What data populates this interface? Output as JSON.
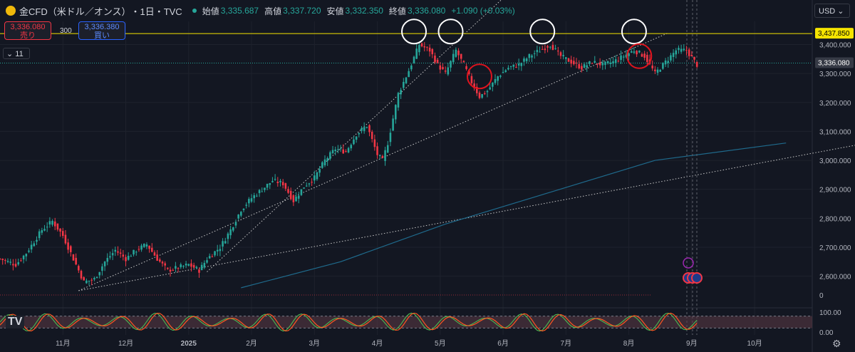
{
  "header": {
    "symbol": "金CFD（米ドル／オンス）",
    "interval": "・1日・TVC",
    "open_label": "始値",
    "open": "3,335.687",
    "high_label": "高値",
    "high": "3,337.720",
    "low_label": "安値",
    "low": "3,332.350",
    "close_label": "終値",
    "close": "3,336.080",
    "change": "+1.090 (+0.03%)"
  },
  "trade": {
    "sell_price": "3,336.080",
    "sell_label": "売り",
    "quantity": "300",
    "buy_price": "3,336.380",
    "buy_label": "買い"
  },
  "indicator_toggle": "11",
  "currency": "USD",
  "colors": {
    "up": "#26a69a",
    "down": "#f23645",
    "background": "#131722",
    "level_line": "#f5e400",
    "ma": "#1f6a8c",
    "stoch_k": "#4caf50",
    "stoch_d": "#ff5722"
  },
  "chart_data": {
    "type": "candlestick",
    "x_tick_labels": [
      "11月",
      "12月",
      "2025",
      "2月",
      "3月",
      "4月",
      "5月",
      "6月",
      "7月",
      "8月",
      "9月",
      "10月"
    ],
    "y_tick_labels": [
      "3,400.000",
      "3,300.000",
      "3,200.000",
      "3,100.000",
      "3,000.000",
      "2,900.000",
      "2,800.000",
      "2,700.000",
      "2,600.000"
    ],
    "ylim": [
      2540,
      3480
    ],
    "current_price": "3,336.080",
    "resistance_level": "3,437.850",
    "volume_axis_label": "0",
    "oscillator": {
      "tick_labels": [
        "100.00",
        "0.00"
      ],
      "ylim": [
        0,
        100
      ],
      "band": [
        20,
        80
      ]
    },
    "price_path": [
      [
        0,
        2660
      ],
      [
        6,
        2640
      ],
      [
        10,
        2680
      ],
      [
        16,
        2760
      ],
      [
        20,
        2790
      ],
      [
        24,
        2740
      ],
      [
        28,
        2660
      ],
      [
        32,
        2580
      ],
      [
        36,
        2590
      ],
      [
        40,
        2650
      ],
      [
        44,
        2690
      ],
      [
        48,
        2660
      ],
      [
        52,
        2690
      ],
      [
        56,
        2710
      ],
      [
        60,
        2660
      ],
      [
        64,
        2620
      ],
      [
        68,
        2630
      ],
      [
        72,
        2640
      ],
      [
        76,
        2620
      ],
      [
        79,
        2660
      ],
      [
        84,
        2700
      ],
      [
        88,
        2760
      ],
      [
        92,
        2830
      ],
      [
        96,
        2870
      ],
      [
        100,
        2900
      ],
      [
        104,
        2930
      ],
      [
        108,
        2920
      ],
      [
        112,
        2860
      ],
      [
        116,
        2910
      ],
      [
        120,
        2940
      ],
      [
        124,
        3000
      ],
      [
        128,
        3040
      ],
      [
        132,
        3030
      ],
      [
        136,
        3090
      ],
      [
        140,
        3120
      ],
      [
        144,
        3020
      ],
      [
        146,
        3000
      ],
      [
        148,
        3060
      ],
      [
        152,
        3230
      ],
      [
        156,
        3310
      ],
      [
        160,
        3400
      ],
      [
        164,
        3380
      ],
      [
        167,
        3330
      ],
      [
        170,
        3300
      ],
      [
        174,
        3380
      ],
      [
        177,
        3330
      ],
      [
        180,
        3270
      ],
      [
        183,
        3220
      ],
      [
        186,
        3240
      ],
      [
        190,
        3290
      ],
      [
        194,
        3320
      ],
      [
        198,
        3330
      ],
      [
        202,
        3360
      ],
      [
        206,
        3380
      ],
      [
        210,
        3400
      ],
      [
        214,
        3360
      ],
      [
        218,
        3340
      ],
      [
        222,
        3320
      ],
      [
        226,
        3340
      ],
      [
        230,
        3330
      ],
      [
        234,
        3340
      ],
      [
        238,
        3360
      ],
      [
        242,
        3380
      ],
      [
        246,
        3360
      ],
      [
        250,
        3300
      ],
      [
        254,
        3340
      ],
      [
        258,
        3380
      ],
      [
        262,
        3380
      ],
      [
        266,
        3330
      ]
    ],
    "circle_marks": [
      {
        "x": 158,
        "price": 3445,
        "color": "white"
      },
      {
        "x": 172,
        "price": 3445,
        "color": "white"
      },
      {
        "x": 207,
        "price": 3445,
        "color": "white"
      },
      {
        "x": 242,
        "price": 3445,
        "color": "white"
      },
      {
        "x": 183,
        "price": 3290,
        "color": "red"
      },
      {
        "x": 244,
        "price": 3360,
        "color": "red"
      }
    ],
    "trend_lines": [
      {
        "from": [
          79,
          2615
        ],
        "to": [
          192,
          3560
        ],
        "style": "dotted"
      },
      {
        "from": [
          30,
          2550
        ],
        "to": [
          255,
          3440
        ],
        "style": "dotted"
      },
      {
        "from": [
          30,
          2550
        ],
        "to": [
          390,
          3160
        ],
        "style": "dotted"
      }
    ],
    "moving_average": [
      [
        92,
        2560
      ],
      [
        130,
        2650
      ],
      [
        170,
        2780
      ],
      [
        210,
        2890
      ],
      [
        250,
        3000
      ],
      [
        300,
        3060
      ]
    ],
    "x_range": [
      0,
      310
    ],
    "x_tick_index": [
      24,
      48,
      72,
      96,
      120,
      144,
      168,
      192,
      216,
      240,
      264,
      288
    ]
  }
}
